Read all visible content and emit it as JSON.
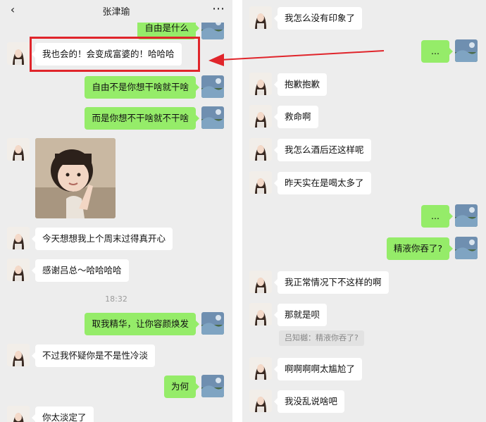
{
  "left_chat": {
    "back_icon": "chevron-left-icon",
    "title": "张津瑜",
    "more_icon": "ellipsis-icon",
    "top_partial_message": "自由是什么",
    "messages": [
      {
        "dir": "in",
        "text": "我也会的！会变成富婆的！哈哈哈"
      },
      {
        "dir": "out",
        "text": "自由不是你想干啥就干啥"
      },
      {
        "dir": "out",
        "text": "而是你想不干啥就不干啥"
      },
      {
        "dir": "in",
        "image": "toddler-clapping-photo"
      },
      {
        "dir": "in",
        "text": "今天想想我上个周末过得真开心"
      },
      {
        "dir": "in",
        "text": "感谢吕总～哈哈哈哈"
      },
      {
        "dir": "out",
        "text": "取我精华，让你容颜焕发"
      },
      {
        "dir": "in",
        "text": "不过我怀疑你是不是性冷淡"
      },
      {
        "dir": "out",
        "text": "为何"
      },
      {
        "dir": "in",
        "text": "你太淡定了"
      }
    ],
    "timestamp": "18:32"
  },
  "right_chat": {
    "messages": [
      {
        "dir": "in",
        "text": "我怎么没有印象了"
      },
      {
        "dir": "out",
        "text": "..."
      },
      {
        "dir": "in",
        "text": "抱歉抱歉"
      },
      {
        "dir": "in",
        "text": "救命啊"
      },
      {
        "dir": "in",
        "text": "我怎么酒后还这样呢"
      },
      {
        "dir": "in",
        "text": "昨天实在是喝太多了"
      },
      {
        "dir": "out",
        "text": "..."
      },
      {
        "dir": "out",
        "text": "精液你吞了?"
      },
      {
        "dir": "in",
        "text": "我正常情况下不这样的啊"
      },
      {
        "dir": "in",
        "text": "那就是呗"
      },
      {
        "dir": "in",
        "text": "啊啊啊啊太尴尬了"
      },
      {
        "dir": "in",
        "text": "我没乱说啥吧"
      }
    ],
    "quote": "吕知樾：精液你吞了?"
  },
  "annotation": {
    "highlight_color": "#e0252b",
    "arrow_icon": "red-arrow-icon"
  },
  "colors": {
    "chat_background": "#ededed",
    "outgoing_bubble": "#95ec69",
    "incoming_bubble": "#ffffff"
  }
}
